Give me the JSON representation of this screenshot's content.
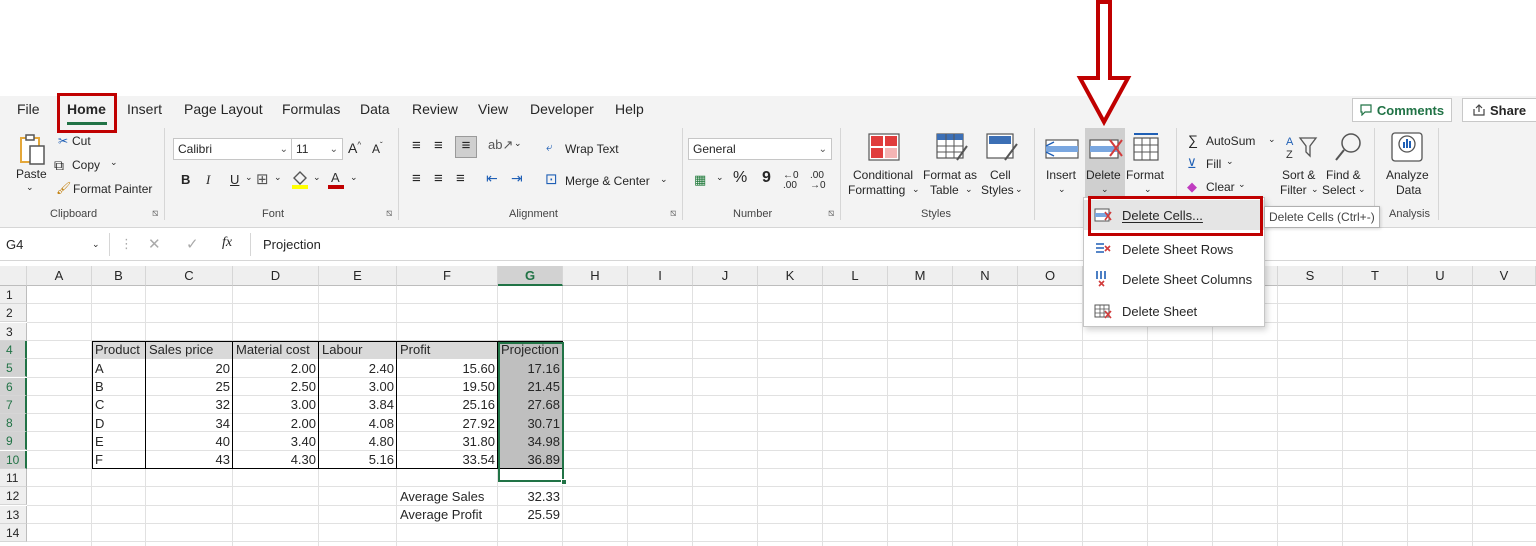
{
  "tabs": [
    "File",
    "Home",
    "Insert",
    "Page Layout",
    "Formulas",
    "Data",
    "Review",
    "View",
    "Developer",
    "Help"
  ],
  "hidden_tab_letter": "E",
  "comments_label": "Comments",
  "share_label": "Share",
  "clipboard": {
    "paste": "Paste",
    "cut": "Cut",
    "copy": "Copy",
    "format_painter": "Format Painter",
    "label": "Clipboard"
  },
  "font": {
    "name": "Calibri",
    "size": "11",
    "bold": "B",
    "italic": "I",
    "underline": "U",
    "label": "Font"
  },
  "alignment": {
    "wrap_text": "Wrap Text",
    "merge_center": "Merge & Center",
    "label": "Alignment"
  },
  "number": {
    "format": "General",
    "percent": "%",
    "comma": "9",
    "label": "Number"
  },
  "styles": {
    "conditional_1": "Conditional",
    "conditional_2": "Formatting",
    "format_as_1": "Format as",
    "format_as_2": "Table",
    "cell_1": "Cell",
    "cell_2": "Styles",
    "label": "Styles"
  },
  "cells": {
    "insert": "Insert",
    "delete": "Delete",
    "format": "Format"
  },
  "editing": {
    "autosum": "AutoSum",
    "fill": "Fill",
    "clear": "Clear",
    "sort_1": "Sort &",
    "sort_2": "Filter",
    "find_1": "Find &",
    "find_2": "Select"
  },
  "analysis": {
    "analyze_1": "Analyze",
    "analyze_2": "Data",
    "label": "Analysis"
  },
  "formula_bar": {
    "name_box": "G4",
    "fx": "fx",
    "content": "Projection"
  },
  "columns": [
    "A",
    "B",
    "C",
    "D",
    "E",
    "F",
    "G",
    "H",
    "I",
    "J",
    "K",
    "L",
    "M",
    "N",
    "O",
    "P",
    "Q",
    "R",
    "S",
    "T",
    "U",
    "V"
  ],
  "rows": [
    "1",
    "2",
    "3",
    "4",
    "5",
    "6",
    "7",
    "8",
    "9",
    "10",
    "11",
    "12",
    "13",
    "14"
  ],
  "table": {
    "headers": [
      "Product",
      "Sales price",
      "Material cost",
      "Labour",
      "Profit",
      "Projection"
    ],
    "data": [
      [
        "A",
        "20",
        "2.00",
        "2.40",
        "15.60",
        "17.16"
      ],
      [
        "B",
        "25",
        "2.50",
        "3.00",
        "19.50",
        "21.45"
      ],
      [
        "C",
        "32",
        "3.00",
        "3.84",
        "25.16",
        "27.68"
      ],
      [
        "D",
        "34",
        "2.00",
        "4.08",
        "27.92",
        "30.71"
      ],
      [
        "E",
        "40",
        "3.40",
        "4.80",
        "31.80",
        "34.98"
      ],
      [
        "F",
        "43",
        "4.30",
        "5.16",
        "33.54",
        "36.89"
      ]
    ]
  },
  "summary": [
    {
      "label": "Average Sales",
      "value": "32.33"
    },
    {
      "label": "Average Profit",
      "value": "25.59"
    }
  ],
  "delete_menu": [
    {
      "icon": "delete-cells-icon",
      "label": "Delete Cells...",
      "key": "D"
    },
    {
      "icon": "delete-rows-icon",
      "label": "Delete Sheet Rows",
      "key": "R"
    },
    {
      "icon": "delete-columns-icon",
      "label": "Delete Sheet Columns",
      "key": "C"
    },
    {
      "icon": "delete-sheet-icon",
      "label": "Delete Sheet",
      "key": "S"
    }
  ],
  "tooltip": "Delete Cells (Ctrl+-)",
  "colors": {
    "accent_green": "#217346",
    "highlight_red": "#c00000",
    "header_fill": "#d9d9d9",
    "projection_fill": "#bfbfbf"
  }
}
